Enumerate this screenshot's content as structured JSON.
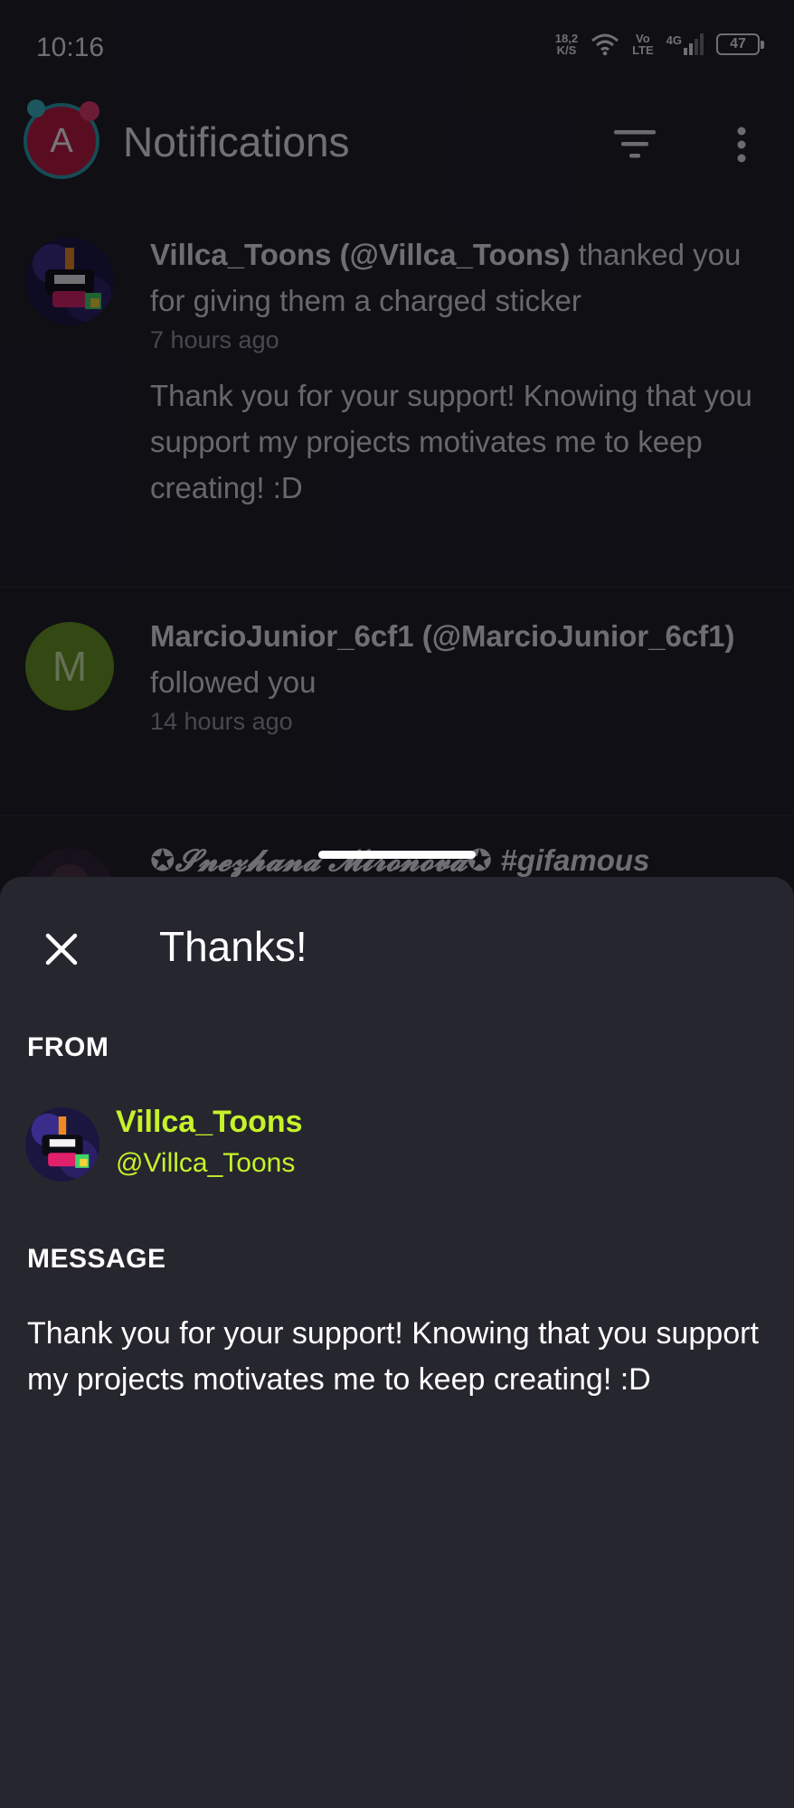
{
  "status_bar": {
    "time": "10:16",
    "speed_value": "18,2",
    "speed_unit": "K/S",
    "volte_top": "Vo",
    "volte_bottom": "LTE",
    "network": "4G",
    "battery": "47"
  },
  "app_bar": {
    "avatar_initial": "A",
    "title": "Notifications",
    "filter_icon": "filter-icon",
    "more_icon": "more-vert-icon"
  },
  "notifications": [
    {
      "user": "Villca_Toons (@Villca_Toons)",
      "action": "thanked you for giving them a charged sticker",
      "time": "7 hours ago",
      "message": "Thank you for your support! Knowing that you support my projects motivates me to keep creating! :D"
    },
    {
      "avatar_initial": "M",
      "user": "MarcioJunior_6cf1 (@MarcioJunior_6cf1)",
      "action": "followed you",
      "time": "14 hours ago"
    },
    {
      "user_partial": "✪𝓢𝓷𝓮𝔃𝓱𝓪𝓷𝓪 𝓜𝓲𝓻𝓸𝓷𝓸𝓿𝓪✪ #gifamous"
    }
  ],
  "sheet": {
    "title": "Thanks!",
    "close_icon": "close-icon",
    "from_label": "FROM",
    "from_name": "Villca_Toons",
    "from_handle": "@Villca_Toons",
    "message_label": "MESSAGE",
    "message": "Thank you for your support! Knowing that you support my projects motivates me to keep creating! :D",
    "accent_color": "#c6f22a"
  }
}
